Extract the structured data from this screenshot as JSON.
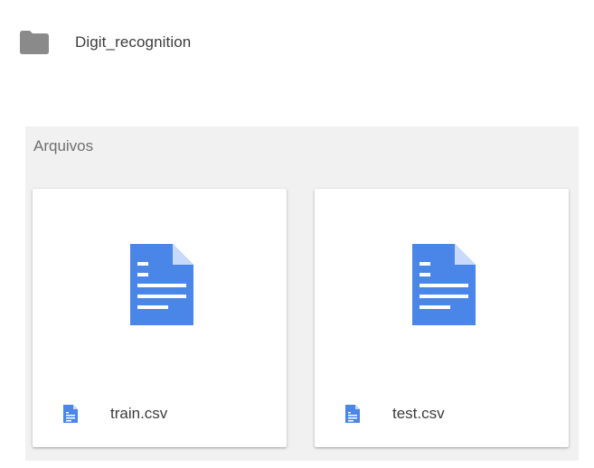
{
  "folder": {
    "name": "Digit_recognition",
    "icon": "folder-icon",
    "icon_color": "#8a8a8a"
  },
  "files_section": {
    "title": "Arquivos",
    "background": "#f1f1f1",
    "files": [
      {
        "name": "train.csv",
        "icon": "google-docs-icon",
        "icon_color": "#4a86e8"
      },
      {
        "name": "test.csv",
        "icon": "google-docs-icon",
        "icon_color": "#4a86e8"
      }
    ]
  }
}
